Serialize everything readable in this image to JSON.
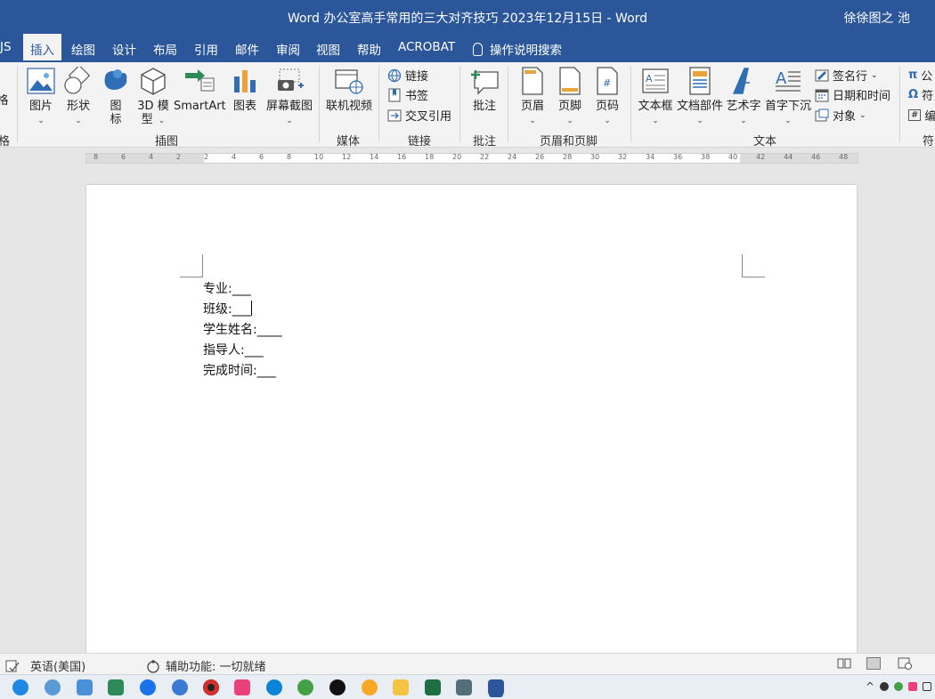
{
  "window": {
    "title": "Word  办公室高手常用的三大对齐技巧 2023年12月15日  -  Word",
    "user": "徐徐图之 池"
  },
  "tabs": [
    {
      "label": "JS"
    },
    {
      "label": "插入"
    },
    {
      "label": "绘图"
    },
    {
      "label": "设计"
    },
    {
      "label": "布局"
    },
    {
      "label": "引用"
    },
    {
      "label": "邮件"
    },
    {
      "label": "审阅"
    },
    {
      "label": "视图"
    },
    {
      "label": "帮助"
    },
    {
      "label": "ACROBAT"
    },
    {
      "label": "操作说明搜索"
    }
  ],
  "ribbon": {
    "partial_left_label": "格",
    "partial_left_group": "格",
    "illustrations": {
      "group_label": "插图",
      "picture": "图片",
      "shapes": "形状",
      "icons_1": "图",
      "icons_2": "标",
      "model3d_1": "3D 模",
      "model3d_2": "型",
      "smartart": "SmartArt",
      "chart": "图表",
      "screenshot": "屏幕截图"
    },
    "media": {
      "group_label": "媒体",
      "online_video": "联机视频"
    },
    "links": {
      "group_label": "链接",
      "link": "链接",
      "bookmark": "书签",
      "cross_ref": "交叉引用"
    },
    "comments": {
      "group_label": "批注",
      "comment": "批注"
    },
    "header_footer": {
      "group_label": "页眉和页脚",
      "header": "页眉",
      "footer": "页脚",
      "page_number": "页码"
    },
    "text": {
      "group_label": "文本",
      "textbox": "文本框",
      "quick_parts": "文档部件",
      "wordart": "艺术字",
      "dropcap": "首字下沉",
      "signature": "签名行",
      "datetime": "日期和时间",
      "object": "对象"
    },
    "symbols": {
      "group_label": "符",
      "equation": "公",
      "symbol": "符",
      "number": "编"
    }
  },
  "ruler": {
    "numbers": [
      "8",
      "6",
      "4",
      "2",
      "2",
      "4",
      "6",
      "8",
      "10",
      "12",
      "14",
      "16",
      "18",
      "20",
      "22",
      "24",
      "26",
      "28",
      "30",
      "32",
      "34",
      "36",
      "38",
      "40",
      "42",
      "44",
      "46",
      "48"
    ]
  },
  "document": {
    "lines": [
      {
        "label": "专业:",
        "blank": "___"
      },
      {
        "label": "班级:",
        "blank": "___"
      },
      {
        "label": "学生姓名:",
        "blank": "____"
      },
      {
        "label": "指导人:",
        "blank": "___"
      },
      {
        "label": "完成时间:",
        "blank": "___"
      }
    ]
  },
  "statusbar": {
    "language": "英语(美国)",
    "accessibility": "辅助功能: 一切就绪"
  },
  "colors": {
    "titlebar": "#2b579a",
    "ribbon": "#f3f3f3"
  }
}
